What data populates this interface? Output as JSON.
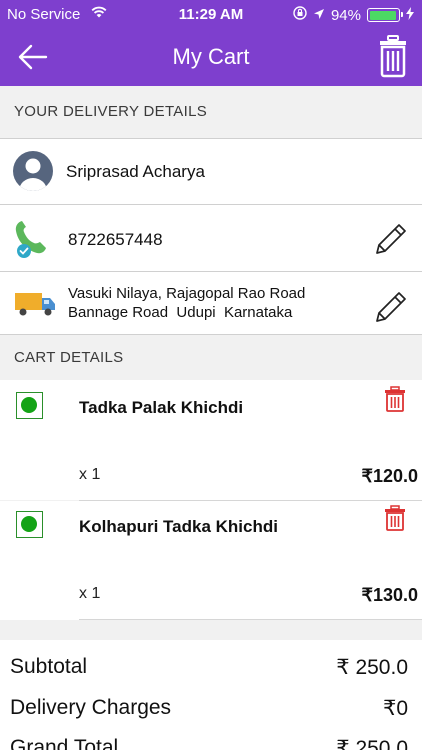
{
  "status_bar": {
    "carrier": "No Service",
    "time": "11:29 AM",
    "battery": "94%",
    "battery_level": 0.94
  },
  "header": {
    "title": "My Cart",
    "icons": {
      "back": "arrow-left-icon",
      "clear": "trash-icon"
    },
    "colors": {
      "brand": "#7e3fce"
    }
  },
  "delivery": {
    "section_title": "YOUR DELIVERY DETAILS",
    "name": "Sriprasad Acharya",
    "phone": "8722657448",
    "address_line1": "Vasuki Nilaya, Rajagopal Rao Road",
    "address_line2": "Bannage Road  Udupi  Karnataka"
  },
  "cart": {
    "section_title": "CART DETAILS",
    "items": [
      {
        "name": "Tadka Palak Khichdi",
        "qty": "x 1",
        "price": "₹120.0"
      },
      {
        "name": "Kolhapuri Tadka Khichdi",
        "qty": "x 1",
        "price": "₹130.0"
      }
    ]
  },
  "totals": {
    "subtotal_label": "Subtotal",
    "subtotal_value": "₹ 250.0",
    "delivery_label": "Delivery Charges",
    "delivery_value": "₹0",
    "grand_label": "Grand Total",
    "grand_value": "₹ 250.0"
  }
}
